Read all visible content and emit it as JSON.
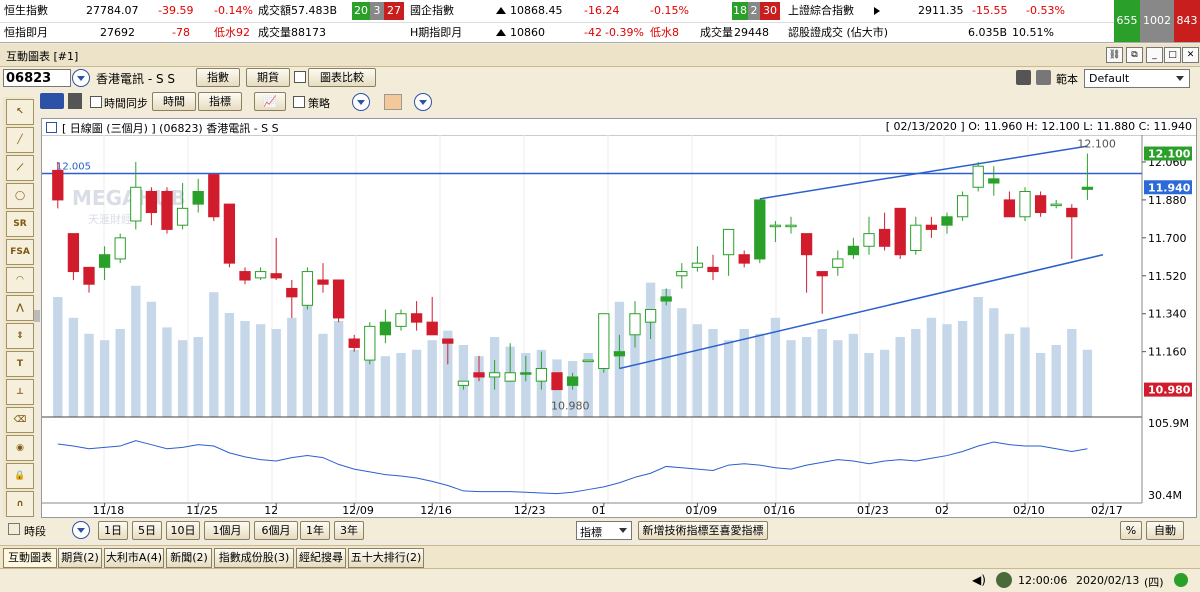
{
  "ticker": {
    "row1": [
      {
        "label": "恒生指數",
        "value": "27784.07",
        "change": "-39.59",
        "pct": "-0.14%",
        "vol_label": "成交額",
        "vol": "57.483B",
        "b_up": "20",
        "b_flat": "3",
        "b_down": "27"
      },
      {
        "label": "國企指數",
        "value": "10868.45",
        "change": "-16.24",
        "pct": "-0.15%",
        "b_up": "18",
        "b_flat": "2",
        "b_down": "30"
      },
      {
        "label": "上證綜合指數",
        "value": "2911.35",
        "change": "-15.55",
        "pct": "-0.53%"
      }
    ],
    "row2": [
      {
        "label": "恒指即月",
        "value": "27692",
        "change": "-78",
        "basis": "低水92",
        "vol_label": "成交量",
        "vol": "88173"
      },
      {
        "label": "H期指即月",
        "value": "10860",
        "change": "-42",
        "pct": "-0.39%",
        "basis": "低水8",
        "vol_label": "成交量",
        "vol": "29448"
      },
      {
        "label": "認股證成交 (佔大市)",
        "value": "6.035B",
        "pct": "10.51%"
      }
    ],
    "breadth": {
      "up": "655",
      "flat": "1002",
      "down": "843"
    }
  },
  "window": {
    "title": "互動圖表 [#1]"
  },
  "toolbar1": {
    "code": "06823",
    "name": "香港電訊 - S S",
    "btn_index": "指數",
    "btn_futures": "期貨",
    "btn_compare": "圖表比較",
    "template_label": "範本",
    "template_value": "Default"
  },
  "toolbar2": {
    "sync_label": "時間同步",
    "btn_time": "時間",
    "btn_indicator": "指標",
    "strategy_label": "策略"
  },
  "tools": [
    "SR",
    "FSA"
  ],
  "chart": {
    "header_left": "[ 日線圖 (三個月) ]  (06823)  香港電訊 - S S",
    "header_right": "[ 02/13/2020 ]  O: 11.960  H: 12.100  L: 11.880  C: 11.940",
    "watermark1": "MEGAHUB",
    "watermark2": "天滙財經",
    "label_high": "12.100",
    "label_line": "12.005",
    "label_low": "10.980",
    "price_ticks": [
      "12.060",
      "11.880",
      "11.700",
      "11.520",
      "11.340",
      "11.160"
    ],
    "tag_high": "12.100",
    "tag_close": "11.940",
    "tag_low": "10.980",
    "vol_high": "105.9M",
    "vol_low": "30.4M",
    "date_labels": [
      "11/18",
      "11/25",
      "12",
      "12/09",
      "12/16",
      "12/23",
      "01",
      "01/09",
      "01/16",
      "01/23",
      "02",
      "02/10",
      "02/17"
    ],
    "colors": {
      "up": "#2aa02a",
      "down": "#d01c2c",
      "trend": "#2a5fd0",
      "volume": "#c5d7e8",
      "hline": "#2a5fd0"
    }
  },
  "chart_data": {
    "type": "candlestick",
    "title": "[ 日線圖 (三個月) ]  (06823)  香港電訊 - S S",
    "ylim": [
      10.85,
      12.15
    ],
    "horizontal_line": 12.005,
    "candles": [
      {
        "o": 12.02,
        "h": 12.06,
        "l": 11.84,
        "c": 11.88
      },
      {
        "o": 11.72,
        "h": 11.72,
        "l": 11.5,
        "c": 11.54
      },
      {
        "o": 11.56,
        "h": 11.56,
        "l": 11.44,
        "c": 11.48
      },
      {
        "o": 11.56,
        "h": 11.66,
        "l": 11.5,
        "c": 11.62
      },
      {
        "o": 11.6,
        "h": 11.72,
        "l": 11.58,
        "c": 11.7
      },
      {
        "o": 11.78,
        "h": 12.06,
        "l": 11.74,
        "c": 11.94
      },
      {
        "o": 11.92,
        "h": 11.94,
        "l": 11.76,
        "c": 11.82
      },
      {
        "o": 11.92,
        "h": 11.94,
        "l": 11.72,
        "c": 11.74
      },
      {
        "o": 11.76,
        "h": 11.96,
        "l": 11.74,
        "c": 11.84
      },
      {
        "o": 11.86,
        "h": 11.98,
        "l": 11.82,
        "c": 11.92
      },
      {
        "o": 12.0,
        "h": 12.0,
        "l": 11.78,
        "c": 11.8
      },
      {
        "o": 11.86,
        "h": 11.86,
        "l": 11.56,
        "c": 11.58
      },
      {
        "o": 11.54,
        "h": 11.56,
        "l": 11.48,
        "c": 11.5
      },
      {
        "o": 11.51,
        "h": 11.56,
        "l": 11.5,
        "c": 11.54
      },
      {
        "o": 11.53,
        "h": 11.7,
        "l": 11.5,
        "c": 11.51
      },
      {
        "o": 11.46,
        "h": 11.5,
        "l": 11.32,
        "c": 11.42
      },
      {
        "o": 11.38,
        "h": 11.56,
        "l": 11.36,
        "c": 11.54
      },
      {
        "o": 11.5,
        "h": 11.58,
        "l": 11.44,
        "c": 11.48
      },
      {
        "o": 11.5,
        "h": 11.5,
        "l": 11.3,
        "c": 11.32
      },
      {
        "o": 11.22,
        "h": 11.24,
        "l": 11.16,
        "c": 11.18
      },
      {
        "o": 11.12,
        "h": 11.3,
        "l": 11.1,
        "c": 11.28
      },
      {
        "o": 11.24,
        "h": 11.36,
        "l": 11.2,
        "c": 11.3
      },
      {
        "o": 11.28,
        "h": 11.36,
        "l": 11.26,
        "c": 11.34
      },
      {
        "o": 11.34,
        "h": 11.4,
        "l": 11.26,
        "c": 11.3
      },
      {
        "o": 11.3,
        "h": 11.42,
        "l": 11.28,
        "c": 11.24
      },
      {
        "o": 11.22,
        "h": 11.22,
        "l": 11.1,
        "c": 11.2
      },
      {
        "o": 11.0,
        "h": 11.02,
        "l": 10.98,
        "c": 11.02
      },
      {
        "o": 11.06,
        "h": 11.14,
        "l": 11.02,
        "c": 11.04
      },
      {
        "o": 11.04,
        "h": 11.12,
        "l": 10.98,
        "c": 11.06
      },
      {
        "o": 11.02,
        "h": 11.2,
        "l": 11.02,
        "c": 11.06
      },
      {
        "o": 11.06,
        "h": 11.14,
        "l": 11.02,
        "c": 11.06
      },
      {
        "o": 11.02,
        "h": 11.16,
        "l": 10.98,
        "c": 11.08
      },
      {
        "o": 11.06,
        "h": 11.0,
        "l": 10.98,
        "c": 10.98
      },
      {
        "o": 11.0,
        "h": 11.06,
        "l": 10.98,
        "c": 11.04
      },
      {
        "o": 11.12,
        "h": 11.12,
        "l": 11.12,
        "c": 11.12
      },
      {
        "o": 11.08,
        "h": 11.3,
        "l": 11.06,
        "c": 11.34
      },
      {
        "o": 11.14,
        "h": 11.24,
        "l": 11.08,
        "c": 11.16
      },
      {
        "o": 11.24,
        "h": 11.4,
        "l": 11.18,
        "c": 11.34
      },
      {
        "o": 11.3,
        "h": 11.36,
        "l": 11.22,
        "c": 11.36
      },
      {
        "o": 11.4,
        "h": 11.46,
        "l": 11.38,
        "c": 11.42
      },
      {
        "o": 11.52,
        "h": 11.58,
        "l": 11.46,
        "c": 11.54
      },
      {
        "o": 11.56,
        "h": 11.66,
        "l": 11.54,
        "c": 11.58
      },
      {
        "o": 11.56,
        "h": 11.62,
        "l": 11.5,
        "c": 11.54
      },
      {
        "o": 11.62,
        "h": 11.74,
        "l": 11.52,
        "c": 11.74
      },
      {
        "o": 11.62,
        "h": 11.64,
        "l": 11.56,
        "c": 11.58
      },
      {
        "o": 11.6,
        "h": 11.88,
        "l": 11.58,
        "c": 11.88
      },
      {
        "o": 11.76,
        "h": 11.78,
        "l": 11.68,
        "c": 11.76
      },
      {
        "o": 11.76,
        "h": 11.8,
        "l": 11.72,
        "c": 11.76
      },
      {
        "o": 11.72,
        "h": 11.72,
        "l": 11.44,
        "c": 11.62
      },
      {
        "o": 11.54,
        "h": 11.54,
        "l": 11.34,
        "c": 11.52
      },
      {
        "o": 11.56,
        "h": 11.64,
        "l": 11.52,
        "c": 11.6
      },
      {
        "o": 11.62,
        "h": 11.7,
        "l": 11.6,
        "c": 11.66
      },
      {
        "o": 11.66,
        "h": 11.8,
        "l": 11.62,
        "c": 11.72
      },
      {
        "o": 11.74,
        "h": 11.82,
        "l": 11.64,
        "c": 11.66
      },
      {
        "o": 11.84,
        "h": 11.84,
        "l": 11.6,
        "c": 11.62
      },
      {
        "o": 11.64,
        "h": 11.8,
        "l": 11.62,
        "c": 11.76
      },
      {
        "o": 11.76,
        "h": 11.8,
        "l": 11.7,
        "c": 11.74
      },
      {
        "o": 11.76,
        "h": 11.82,
        "l": 11.72,
        "c": 11.8
      },
      {
        "o": 11.8,
        "h": 11.92,
        "l": 11.78,
        "c": 11.9
      },
      {
        "o": 11.94,
        "h": 12.06,
        "l": 11.92,
        "c": 12.04
      },
      {
        "o": 11.96,
        "h": 12.04,
        "l": 11.9,
        "c": 11.98
      },
      {
        "o": 11.88,
        "h": 11.92,
        "l": 11.8,
        "c": 11.8
      },
      {
        "o": 11.8,
        "h": 11.94,
        "l": 11.78,
        "c": 11.92
      },
      {
        "o": 11.9,
        "h": 11.92,
        "l": 11.8,
        "c": 11.82
      },
      {
        "o": 11.86,
        "h": 11.88,
        "l": 11.84,
        "c": 11.86
      },
      {
        "o": 11.84,
        "h": 11.86,
        "l": 11.6,
        "c": 11.8
      },
      {
        "o": 11.93,
        "h": 12.1,
        "l": 11.88,
        "c": 11.94
      }
    ],
    "volumes": [
      0.75,
      0.62,
      0.52,
      0.48,
      0.55,
      0.82,
      0.72,
      0.56,
      0.48,
      0.5,
      0.78,
      0.65,
      0.6,
      0.58,
      0.55,
      0.62,
      0.7,
      0.52,
      0.6,
      0.42,
      0.4,
      0.38,
      0.4,
      0.42,
      0.48,
      0.54,
      0.45,
      0.38,
      0.5,
      0.44,
      0.4,
      0.42,
      0.36,
      0.35,
      0.4,
      0.46,
      0.72,
      0.64,
      0.84,
      0.8,
      0.68,
      0.58,
      0.55,
      0.48,
      0.55,
      0.52,
      0.62,
      0.48,
      0.5,
      0.55,
      0.48,
      0.52,
      0.4,
      0.42,
      0.5,
      0.55,
      0.62,
      0.58,
      0.6,
      0.75,
      0.68,
      0.52,
      0.56,
      0.4,
      0.45,
      0.55,
      0.42
    ],
    "trend_upper": [
      {
        "i": 45,
        "p": 11.885
      },
      {
        "i": 66,
        "p": 12.135
      }
    ],
    "trend_lower": [
      {
        "i": 36,
        "p": 11.08
      },
      {
        "i": 67,
        "p": 11.62
      }
    ],
    "indicator_line": [
      0.75,
      0.72,
      0.68,
      0.7,
      0.72,
      0.8,
      0.74,
      0.68,
      0.7,
      0.74,
      0.72,
      0.62,
      0.56,
      0.52,
      0.5,
      0.55,
      0.58,
      0.55,
      0.45,
      0.38,
      0.34,
      0.3,
      0.28,
      0.25,
      0.2,
      0.14,
      0.06,
      0.05,
      0.05,
      0.05,
      0.04,
      0.03,
      0.02,
      0.04,
      0.08,
      0.12,
      0.18,
      0.26,
      0.32,
      0.42,
      0.4,
      0.38,
      0.36,
      0.44,
      0.46,
      0.44,
      0.4,
      0.38,
      0.44,
      0.48,
      0.52,
      0.5,
      0.46,
      0.5,
      0.52,
      0.5,
      0.54,
      0.58,
      0.64,
      0.72,
      0.78,
      0.74,
      0.72,
      0.72,
      0.68,
      0.64,
      0.68
    ]
  },
  "bottombar": {
    "period_label": "時段",
    "periods": [
      "1日",
      "5日",
      "10日",
      "1個月",
      "6個月",
      "1年",
      "3年"
    ],
    "indicator_label": "指標",
    "add_indicator": "新增技術指標至喜愛指標",
    "pct": "%",
    "auto": "自動"
  },
  "tabs": [
    "互動圖表",
    "期貨(2)",
    "大利市A(4)",
    "新聞(2)",
    "指數成份股(3)",
    "經紀搜尋",
    "五十大排行(2)"
  ],
  "status": {
    "time": "12:00:06",
    "date": "2020/02/13",
    "weekday": "(四)"
  }
}
